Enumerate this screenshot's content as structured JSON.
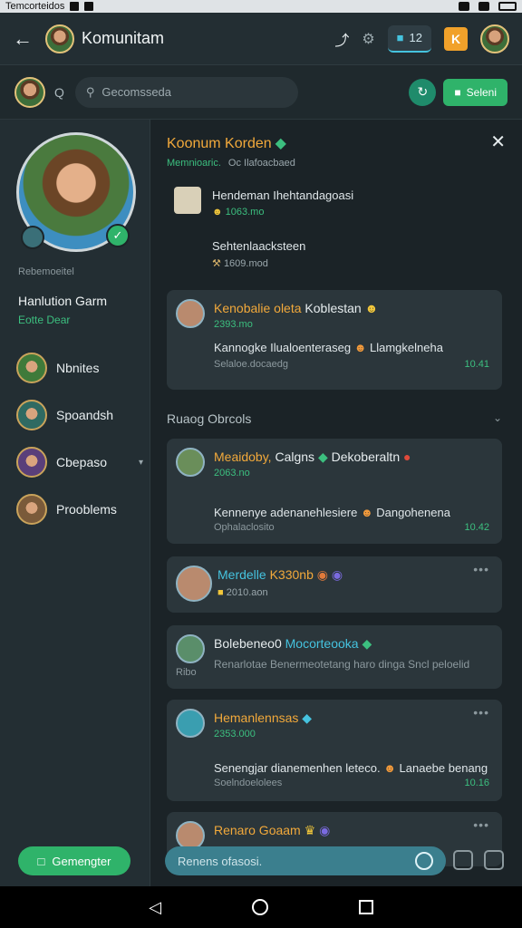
{
  "status": {
    "left_text": "Temcorteidos"
  },
  "appbar": {
    "back_icon": "arrow-left-icon",
    "title": "Komunitam",
    "pill_count": "12"
  },
  "search": {
    "q_label": "Q",
    "placeholder": "Gecomsseda",
    "select_label": "Seleni"
  },
  "sidebar": {
    "subtitle": "Rebemoeitel",
    "name": "Hanlution Garm",
    "role": "Eotte Dear",
    "items": [
      {
        "label": "Nbnites"
      },
      {
        "label": "Spoandsh"
      },
      {
        "label": "Cbepaso"
      },
      {
        "label": "Prooblems"
      }
    ],
    "new_button": "Gemengter"
  },
  "main": {
    "title": "Koonum Korden",
    "meta_green": "Memnioaric.",
    "meta_grey": "Oc Ilafoacbaed",
    "files": [
      {
        "title": "Hendeman Ihehtandagoasi",
        "sub": "1063.mo"
      },
      {
        "title": "Sehtenlaacksteen",
        "sub": "1609.mod"
      }
    ],
    "section_title": "Ruaog Obrcols",
    "cards": [
      {
        "name": "Kenobalie oleta",
        "name2": "Koblestan",
        "date": "2393.mo",
        "body": "Kannogke Ilualoenteraseg",
        "body2": "Llamgkelneha",
        "foot": "Selaloe.docaedg",
        "time": "10.41"
      },
      {
        "name": "Meaidoby,",
        "name2": "Calgns",
        "name3": "Dekoberaltn",
        "date": "2063.no",
        "body": "Kennenye adenanehlesiere",
        "body2": "Dangohenena",
        "foot": "Ophalaclosito",
        "time": "10.42"
      },
      {
        "name": "Merdelle",
        "name2": "K330nb",
        "date": "2010.aon"
      },
      {
        "name": "Bolebeneo0",
        "name2": "Mocorteooka",
        "body": "Renarlotae Benermeotetang haro dinga Sncl peloelid",
        "foot": "Ribo"
      },
      {
        "name": "Hemanlennsas",
        "date": "2353.000",
        "body": "Senengjar dianemenhen leteco.",
        "body2": "Lanaebe benang",
        "foot": "Soelndoelolees",
        "time": "10.16"
      },
      {
        "name": "Renaro Goaam"
      }
    ]
  },
  "composer": {
    "placeholder": "Renens ofasosi."
  }
}
